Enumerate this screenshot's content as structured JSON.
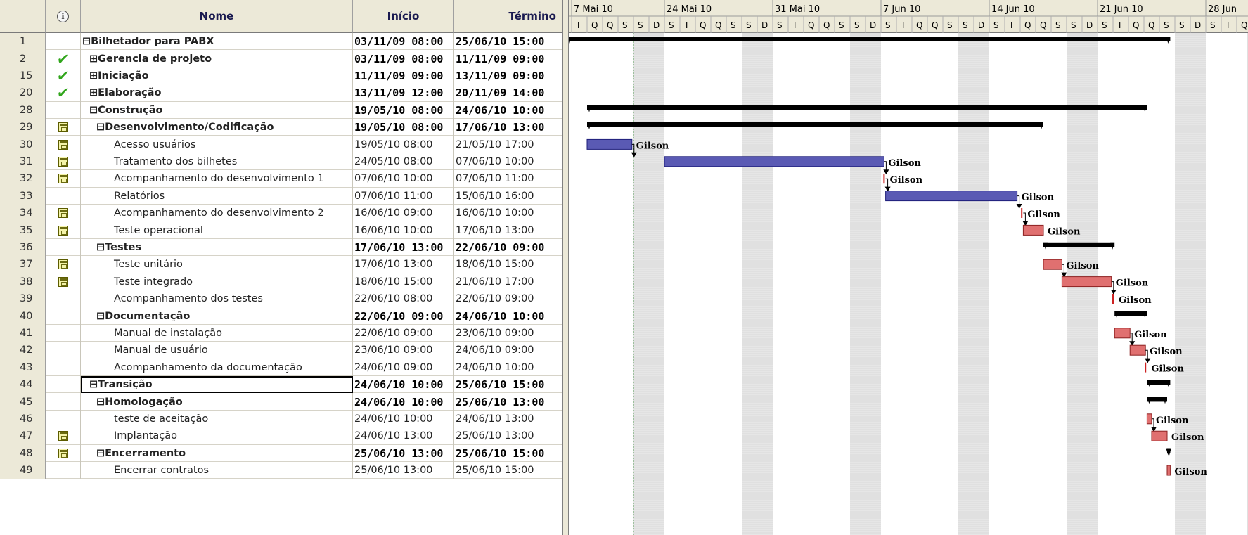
{
  "columns": {
    "id": "",
    "indicator": "info-icon",
    "name": "Nome",
    "start": "Início",
    "end": "Término"
  },
  "tasks": [
    {
      "id": "1",
      "ind": "",
      "name": "⊟Bilhetador para PABX",
      "start": "03/11/09 08:00",
      "end": "25/06/10 15:00",
      "bold": true,
      "level": 0
    },
    {
      "id": "2",
      "ind": "check",
      "name": "⊞Gerencia de projeto",
      "start": "03/11/09 08:00",
      "end": "11/11/09 09:00",
      "bold": true,
      "level": 1
    },
    {
      "id": "15",
      "ind": "check",
      "name": "⊞Iniciação",
      "start": "11/11/09 09:00",
      "end": "13/11/09 09:00",
      "bold": true,
      "level": 1
    },
    {
      "id": "20",
      "ind": "check",
      "name": "⊞Elaboração",
      "start": "13/11/09 12:00",
      "end": "20/11/09 14:00",
      "bold": true,
      "level": 1
    },
    {
      "id": "28",
      "ind": "",
      "name": "⊟Construção",
      "start": "19/05/10 08:00",
      "end": "24/06/10 10:00",
      "bold": true,
      "level": 1
    },
    {
      "id": "29",
      "ind": "cal",
      "name": "⊟Desenvolvimento/Codificação",
      "start": "19/05/10 08:00",
      "end": "17/06/10 13:00",
      "bold": true,
      "level": 2
    },
    {
      "id": "30",
      "ind": "cal",
      "name": "Acesso usuários",
      "start": "19/05/10 08:00",
      "end": "21/05/10 17:00",
      "bold": false,
      "level": 3
    },
    {
      "id": "31",
      "ind": "cal",
      "name": "Tratamento dos bilhetes",
      "start": "24/05/10 08:00",
      "end": "07/06/10 10:00",
      "bold": false,
      "level": 3
    },
    {
      "id": "32",
      "ind": "cal",
      "name": "Acompanhamento do desenvolvimento 1",
      "start": "07/06/10 10:00",
      "end": "07/06/10 11:00",
      "bold": false,
      "level": 3
    },
    {
      "id": "33",
      "ind": "",
      "name": "Relatórios",
      "start": "07/06/10 11:00",
      "end": "15/06/10 16:00",
      "bold": false,
      "level": 3
    },
    {
      "id": "34",
      "ind": "cal",
      "name": "Acompanhamento do desenvolvimento 2",
      "start": "16/06/10 09:00",
      "end": "16/06/10 10:00",
      "bold": false,
      "level": 3
    },
    {
      "id": "35",
      "ind": "cal",
      "name": "Teste operacional",
      "start": "16/06/10 10:00",
      "end": "17/06/10 13:00",
      "bold": false,
      "level": 3
    },
    {
      "id": "36",
      "ind": "",
      "name": "⊟Testes",
      "start": "17/06/10 13:00",
      "end": "22/06/10 09:00",
      "bold": true,
      "level": 2
    },
    {
      "id": "37",
      "ind": "cal",
      "name": "Teste unitário",
      "start": "17/06/10 13:00",
      "end": "18/06/10 15:00",
      "bold": false,
      "level": 3
    },
    {
      "id": "38",
      "ind": "cal",
      "name": "Teste integrado",
      "start": "18/06/10 15:00",
      "end": "21/06/10 17:00",
      "bold": false,
      "level": 3
    },
    {
      "id": "39",
      "ind": "",
      "name": "Acompanhamento dos testes",
      "start": "22/06/10 08:00",
      "end": "22/06/10 09:00",
      "bold": false,
      "level": 3
    },
    {
      "id": "40",
      "ind": "",
      "name": "⊟Documentação",
      "start": "22/06/10 09:00",
      "end": "24/06/10 10:00",
      "bold": true,
      "level": 2
    },
    {
      "id": "41",
      "ind": "",
      "name": "Manual de instalação",
      "start": "22/06/10 09:00",
      "end": "23/06/10 09:00",
      "bold": false,
      "level": 3
    },
    {
      "id": "42",
      "ind": "",
      "name": "Manual de usuário",
      "start": "23/06/10 09:00",
      "end": "24/06/10 09:00",
      "bold": false,
      "level": 3
    },
    {
      "id": "43",
      "ind": "",
      "name": "Acompanhamento da documentação",
      "start": "24/06/10 09:00",
      "end": "24/06/10 10:00",
      "bold": false,
      "level": 3
    },
    {
      "id": "44",
      "ind": "",
      "name": "⊟Transição",
      "start": "24/06/10 10:00",
      "end": "25/06/10 15:00",
      "bold": true,
      "level": 1,
      "selected": true
    },
    {
      "id": "45",
      "ind": "",
      "name": "⊟Homologação",
      "start": "24/06/10 10:00",
      "end": "25/06/10 13:00",
      "bold": true,
      "level": 2
    },
    {
      "id": "46",
      "ind": "",
      "name": "teste de aceitação",
      "start": "24/06/10 10:00",
      "end": "24/06/10 13:00",
      "bold": false,
      "level": 3
    },
    {
      "id": "47",
      "ind": "cal",
      "name": "Implantação",
      "start": "24/06/10 13:00",
      "end": "25/06/10 13:00",
      "bold": false,
      "level": 3
    },
    {
      "id": "48",
      "ind": "cal",
      "name": "⊟Encerramento",
      "start": "25/06/10 13:00",
      "end": "25/06/10 15:00",
      "bold": true,
      "level": 2
    },
    {
      "id": "49",
      "ind": "",
      "name": "Encerrar contratos",
      "start": "25/06/10 13:00",
      "end": "25/06/10 15:00",
      "bold": false,
      "level": 3
    }
  ],
  "timescale": {
    "weeks": [
      "7 Mai 10",
      "24 Mai 10",
      "31 Mai 10",
      "7 Jun 10",
      "14 Jun 10",
      "21 Jun 10",
      "28 Jun"
    ],
    "days": [
      "T",
      "Q",
      "Q",
      "S",
      "S",
      "D",
      "S",
      "T",
      "Q",
      "Q",
      "S",
      "S",
      "D",
      "S",
      "T",
      "Q",
      "Q",
      "S",
      "S",
      "D",
      "S",
      "T",
      "Q",
      "Q",
      "S",
      "S",
      "D",
      "S",
      "T",
      "Q",
      "Q",
      "S",
      "S",
      "D",
      "S",
      "T",
      "Q",
      "Q",
      "S",
      "S",
      "D",
      "S",
      "T",
      "Q"
    ]
  },
  "resource_label": "Gilson",
  "resources": [
    "",
    "",
    "",
    "",
    "",
    "",
    "Gilson",
    "Gilson",
    "Gilson",
    "Gilson",
    "Gilson",
    "Gilson",
    "",
    "Gilson",
    "Gilson",
    "Gilson",
    "",
    "Gilson",
    "Gilson",
    "Gilson",
    "",
    "",
    "Gilson",
    "Gilson",
    "",
    "Gilson"
  ],
  "colors": {
    "normal_bar": "#5a5ab4",
    "critical_bar": "#e07070",
    "summary_bar": "#000000",
    "milestone_link": "#cc2222",
    "nonworking": "#d0d0d0"
  }
}
